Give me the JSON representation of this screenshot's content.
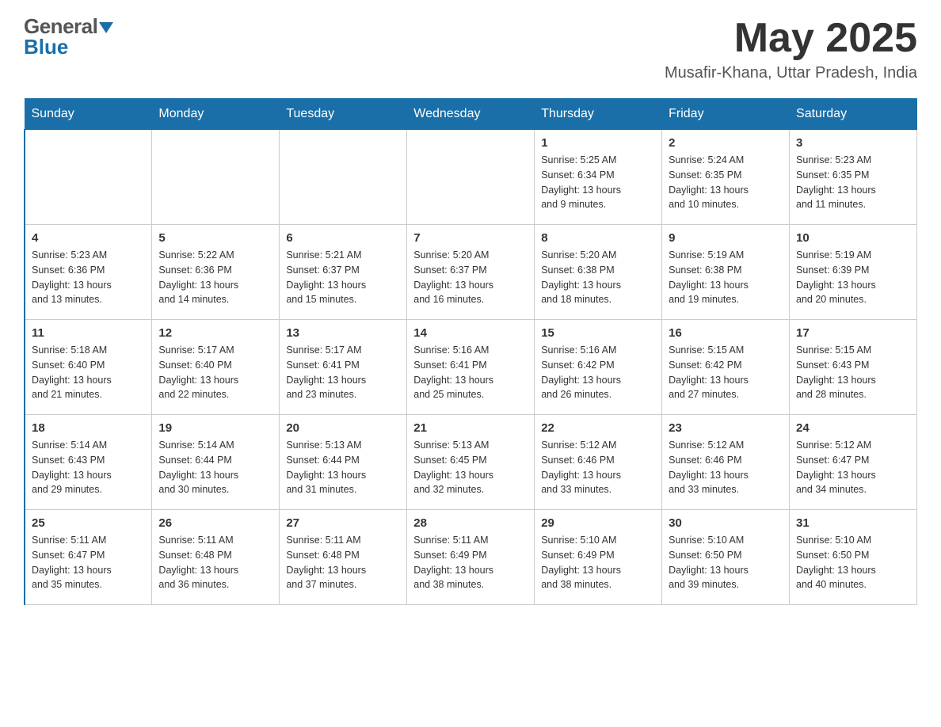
{
  "header": {
    "logo_general": "General",
    "logo_blue": "Blue",
    "month_year": "May 2025",
    "location": "Musafir-Khana, Uttar Pradesh, India"
  },
  "days_of_week": [
    "Sunday",
    "Monday",
    "Tuesday",
    "Wednesday",
    "Thursday",
    "Friday",
    "Saturday"
  ],
  "weeks": [
    [
      {
        "day": "",
        "info": ""
      },
      {
        "day": "",
        "info": ""
      },
      {
        "day": "",
        "info": ""
      },
      {
        "day": "",
        "info": ""
      },
      {
        "day": "1",
        "info": "Sunrise: 5:25 AM\nSunset: 6:34 PM\nDaylight: 13 hours\nand 9 minutes."
      },
      {
        "day": "2",
        "info": "Sunrise: 5:24 AM\nSunset: 6:35 PM\nDaylight: 13 hours\nand 10 minutes."
      },
      {
        "day": "3",
        "info": "Sunrise: 5:23 AM\nSunset: 6:35 PM\nDaylight: 13 hours\nand 11 minutes."
      }
    ],
    [
      {
        "day": "4",
        "info": "Sunrise: 5:23 AM\nSunset: 6:36 PM\nDaylight: 13 hours\nand 13 minutes."
      },
      {
        "day": "5",
        "info": "Sunrise: 5:22 AM\nSunset: 6:36 PM\nDaylight: 13 hours\nand 14 minutes."
      },
      {
        "day": "6",
        "info": "Sunrise: 5:21 AM\nSunset: 6:37 PM\nDaylight: 13 hours\nand 15 minutes."
      },
      {
        "day": "7",
        "info": "Sunrise: 5:20 AM\nSunset: 6:37 PM\nDaylight: 13 hours\nand 16 minutes."
      },
      {
        "day": "8",
        "info": "Sunrise: 5:20 AM\nSunset: 6:38 PM\nDaylight: 13 hours\nand 18 minutes."
      },
      {
        "day": "9",
        "info": "Sunrise: 5:19 AM\nSunset: 6:38 PM\nDaylight: 13 hours\nand 19 minutes."
      },
      {
        "day": "10",
        "info": "Sunrise: 5:19 AM\nSunset: 6:39 PM\nDaylight: 13 hours\nand 20 minutes."
      }
    ],
    [
      {
        "day": "11",
        "info": "Sunrise: 5:18 AM\nSunset: 6:40 PM\nDaylight: 13 hours\nand 21 minutes."
      },
      {
        "day": "12",
        "info": "Sunrise: 5:17 AM\nSunset: 6:40 PM\nDaylight: 13 hours\nand 22 minutes."
      },
      {
        "day": "13",
        "info": "Sunrise: 5:17 AM\nSunset: 6:41 PM\nDaylight: 13 hours\nand 23 minutes."
      },
      {
        "day": "14",
        "info": "Sunrise: 5:16 AM\nSunset: 6:41 PM\nDaylight: 13 hours\nand 25 minutes."
      },
      {
        "day": "15",
        "info": "Sunrise: 5:16 AM\nSunset: 6:42 PM\nDaylight: 13 hours\nand 26 minutes."
      },
      {
        "day": "16",
        "info": "Sunrise: 5:15 AM\nSunset: 6:42 PM\nDaylight: 13 hours\nand 27 minutes."
      },
      {
        "day": "17",
        "info": "Sunrise: 5:15 AM\nSunset: 6:43 PM\nDaylight: 13 hours\nand 28 minutes."
      }
    ],
    [
      {
        "day": "18",
        "info": "Sunrise: 5:14 AM\nSunset: 6:43 PM\nDaylight: 13 hours\nand 29 minutes."
      },
      {
        "day": "19",
        "info": "Sunrise: 5:14 AM\nSunset: 6:44 PM\nDaylight: 13 hours\nand 30 minutes."
      },
      {
        "day": "20",
        "info": "Sunrise: 5:13 AM\nSunset: 6:44 PM\nDaylight: 13 hours\nand 31 minutes."
      },
      {
        "day": "21",
        "info": "Sunrise: 5:13 AM\nSunset: 6:45 PM\nDaylight: 13 hours\nand 32 minutes."
      },
      {
        "day": "22",
        "info": "Sunrise: 5:12 AM\nSunset: 6:46 PM\nDaylight: 13 hours\nand 33 minutes."
      },
      {
        "day": "23",
        "info": "Sunrise: 5:12 AM\nSunset: 6:46 PM\nDaylight: 13 hours\nand 33 minutes."
      },
      {
        "day": "24",
        "info": "Sunrise: 5:12 AM\nSunset: 6:47 PM\nDaylight: 13 hours\nand 34 minutes."
      }
    ],
    [
      {
        "day": "25",
        "info": "Sunrise: 5:11 AM\nSunset: 6:47 PM\nDaylight: 13 hours\nand 35 minutes."
      },
      {
        "day": "26",
        "info": "Sunrise: 5:11 AM\nSunset: 6:48 PM\nDaylight: 13 hours\nand 36 minutes."
      },
      {
        "day": "27",
        "info": "Sunrise: 5:11 AM\nSunset: 6:48 PM\nDaylight: 13 hours\nand 37 minutes."
      },
      {
        "day": "28",
        "info": "Sunrise: 5:11 AM\nSunset: 6:49 PM\nDaylight: 13 hours\nand 38 minutes."
      },
      {
        "day": "29",
        "info": "Sunrise: 5:10 AM\nSunset: 6:49 PM\nDaylight: 13 hours\nand 38 minutes."
      },
      {
        "day": "30",
        "info": "Sunrise: 5:10 AM\nSunset: 6:50 PM\nDaylight: 13 hours\nand 39 minutes."
      },
      {
        "day": "31",
        "info": "Sunrise: 5:10 AM\nSunset: 6:50 PM\nDaylight: 13 hours\nand 40 minutes."
      }
    ]
  ]
}
